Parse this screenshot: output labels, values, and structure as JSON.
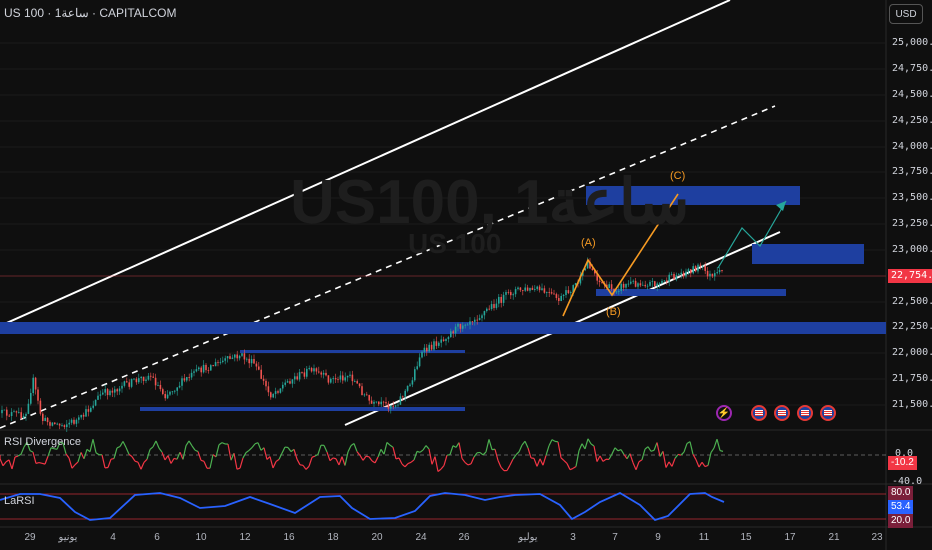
{
  "header": {
    "symbol_line": "US 100 · 1ساعة · CAPITALCOM",
    "currency_button": "USD"
  },
  "watermark": {
    "main": "US100, 1ساعة",
    "sub": "US 100"
  },
  "colors": {
    "bull": "#26a69a",
    "bear": "#ef5350",
    "zone": "#1e3fa0",
    "wave": "#f59a23",
    "channel": "#ffffff",
    "price_line": "#f23645",
    "rsi_green": "#4caf50",
    "rsi_red": "#f23645",
    "larsi_line": "#2962ff"
  },
  "price_axis": {
    "ticks": [
      "25,000.0",
      "24,750.0",
      "24,500.0",
      "24,250.0",
      "24,000.0",
      "23,750.0",
      "23,500.0",
      "23,250.0",
      "23,000.0",
      "22,750.0",
      "22,500.0",
      "22,250.0",
      "22,000.0",
      "21,750.0",
      "21,500.0"
    ],
    "current_price": "22,754.2"
  },
  "wave_labels": {
    "a": "(A)",
    "b": "(B)",
    "c": "(C)"
  },
  "rsi_pane": {
    "title": "RSI Divergence",
    "tick_top": "0.0",
    "tick_bottom": "-40.0",
    "value": "-10.2"
  },
  "larsi_pane": {
    "title": "LaRSI",
    "upper": "80.0",
    "value": "53.4",
    "lower": "20.0"
  },
  "events": [
    "split-icon",
    "us-flag-icon",
    "us-flag-icon",
    "us-flag-icon",
    "us-flag-icon"
  ],
  "time_axis": [
    "29",
    "يونيو",
    "4",
    "6",
    "10",
    "12",
    "16",
    "18",
    "20",
    "24",
    "26",
    "يوليو",
    "3",
    "7",
    "9",
    "11",
    "15",
    "17",
    "21",
    "23"
  ]
}
